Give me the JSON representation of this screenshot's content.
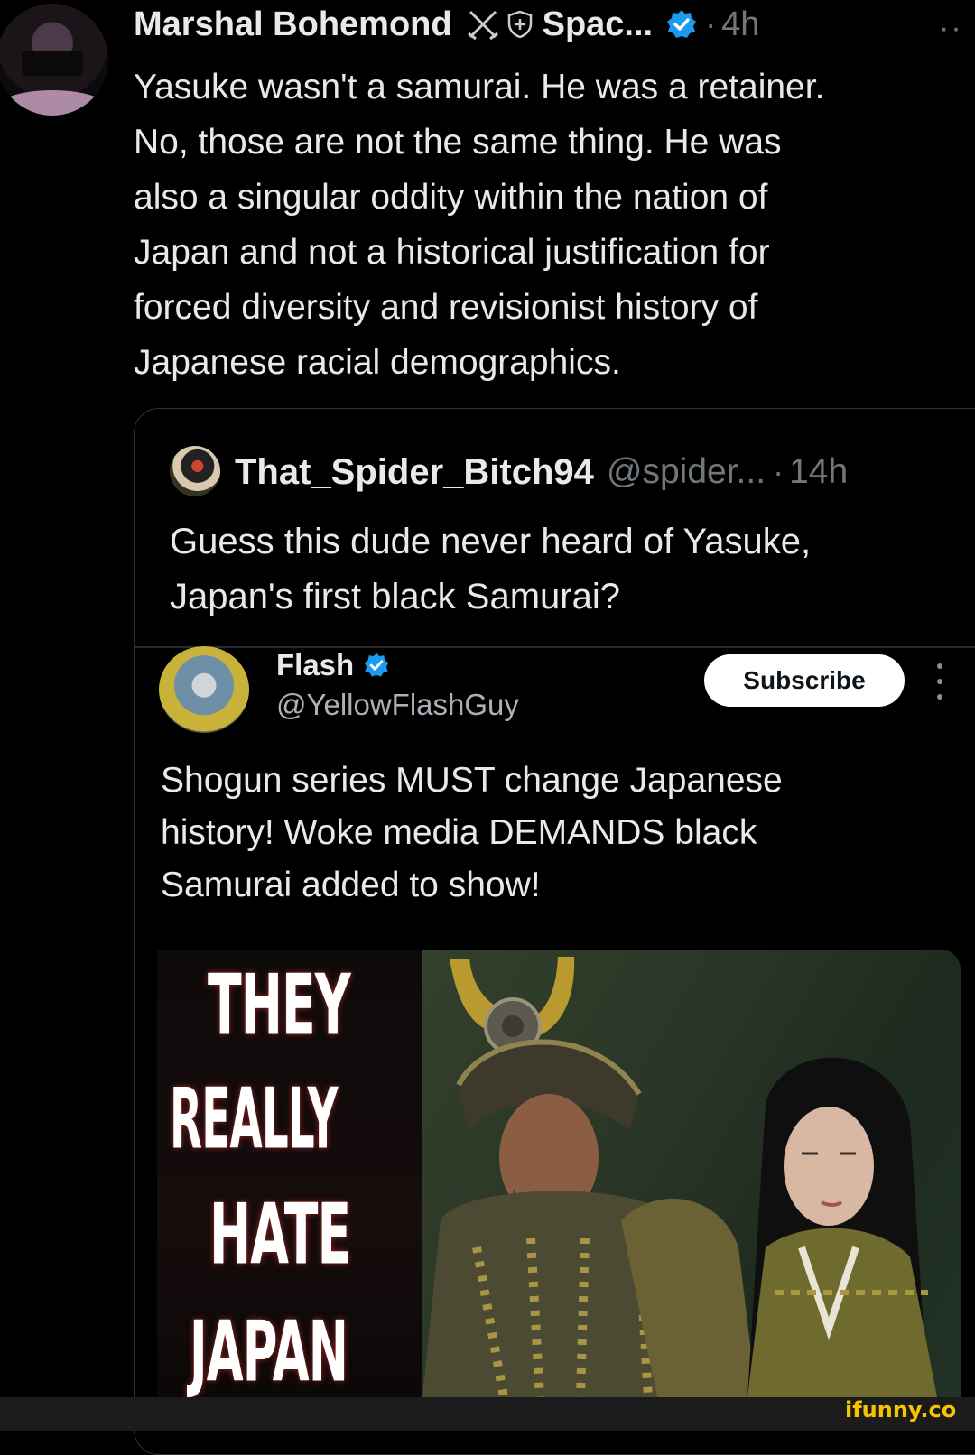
{
  "colors": {
    "background": "#000000",
    "text_primary": "#e7e9ea",
    "text_secondary": "#71767b",
    "verified_blue": "#1d9bf0",
    "watermark_yellow": "#f5c400"
  },
  "tweet": {
    "author_name": "Marshal Bohemond",
    "community_icons": [
      "crossed-swords-icon",
      "shield-icon"
    ],
    "community_name": "Spac...",
    "verified_icon": "verified-badge-icon",
    "separator": "·",
    "time": "4h",
    "more_icon": "more-dots-icon",
    "more_text": "··",
    "body_lines": [
      "Yasuke wasn't a samurai. He was a retainer.",
      "No, those are not the same thing. He was",
      "also a singular oddity within the nation of",
      "Japan and not a historical justification for",
      "forced diversity and revisionist history of",
      "Japanese racial demographics."
    ]
  },
  "quote": {
    "author_name": "That_Spider_Bitch94",
    "handle": "@spider...",
    "separator": "·",
    "time": "14h",
    "body_lines": [
      "Guess this dude never heard of Yasuke,",
      "Japan's first black Samurai?"
    ]
  },
  "embedded": {
    "name": "Flash",
    "verified_icon": "verified-badge-icon",
    "handle": "@YellowFlashGuy",
    "subscribe_label": "Subscribe",
    "menu_icon": "vertical-dots-icon",
    "body_lines": [
      "Shogun series MUST change Japanese",
      "history! Woke media DEMANDS black",
      "Samurai added to show!"
    ],
    "thumbnail_words": [
      "THEY",
      "REALLY",
      "HATE",
      "JAPAN"
    ]
  },
  "watermark": "ifunny.co"
}
